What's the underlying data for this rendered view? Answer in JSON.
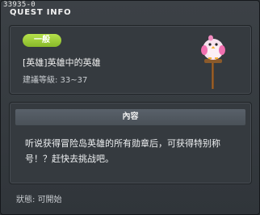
{
  "window": {
    "quest_id": "33935-0",
    "title": "QUEST INFO"
  },
  "quest": {
    "badge": "一般",
    "name": "[英雄]英雄中的英雄",
    "level": "建議等級: 33~37",
    "mascot_icon": "pink-bird-on-signpost-icon"
  },
  "content": {
    "header": "內容",
    "text": "听说获得冒险岛英雄的所有勋章后，可获得特别称号！？赶快去挑战吧。"
  },
  "status": {
    "text": "狀態:  可開始"
  },
  "colors": {
    "badge": "#9ccb35",
    "window_bg": "#353a3f",
    "header_bg": "#515960"
  }
}
